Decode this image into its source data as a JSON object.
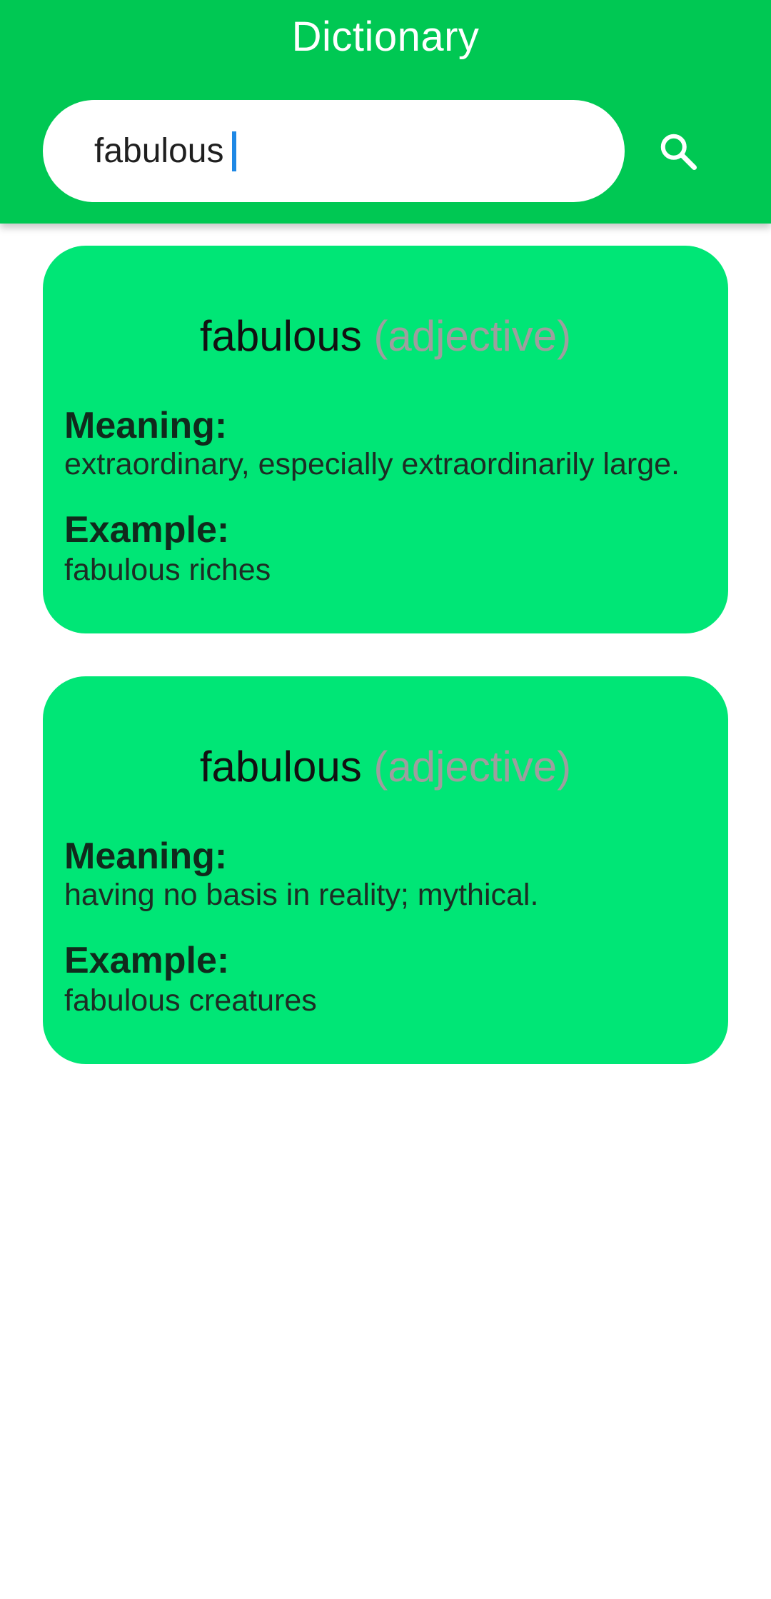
{
  "app": {
    "title": "Dictionary",
    "accent_color": "#00c853",
    "card_color": "#00e676"
  },
  "search": {
    "value": "fabulous",
    "icon": "search-icon"
  },
  "results": [
    {
      "word": "fabulous",
      "part_of_speech": "(adjective)",
      "meaning_label": "Meaning:",
      "meaning": "extraordinary, especially extraordinarily large.",
      "example_label": "Example:",
      "example": "fabulous riches"
    },
    {
      "word": "fabulous",
      "part_of_speech": "(adjective)",
      "meaning_label": "Meaning:",
      "meaning": "having no basis in reality; mythical.",
      "example_label": "Example:",
      "example": "fabulous creatures"
    }
  ]
}
